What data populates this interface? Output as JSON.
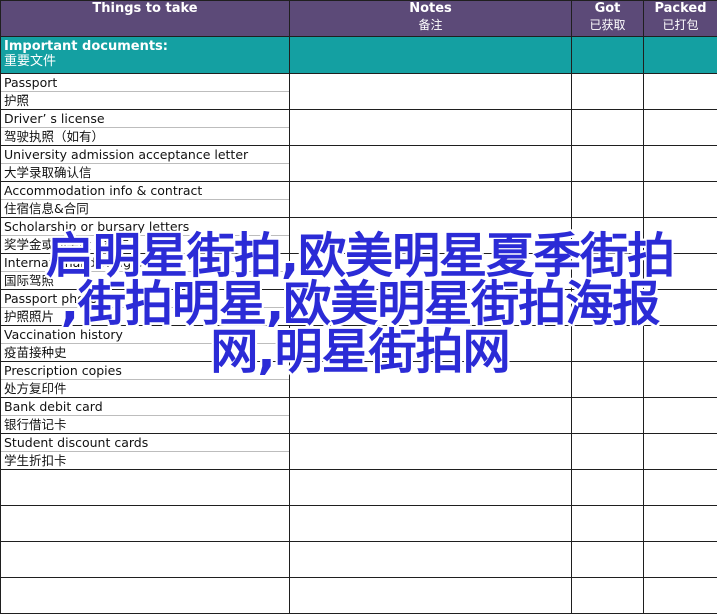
{
  "header": {
    "things": "Things to take",
    "notes_en": "Notes",
    "notes_zh": "备注",
    "got_en": "Got",
    "got_zh": "已获取",
    "packed_en": "Packed",
    "packed_zh": "已打包"
  },
  "section": {
    "title_en": "Important documents:",
    "title_zh": "重要文件"
  },
  "items": [
    {
      "en": "Passport",
      "zh": "护照"
    },
    {
      "en": "Driver’ s license",
      "zh": "驾驶执照（如有）"
    },
    {
      "en": "University admission acceptance letter",
      "zh": "大学录取确认信"
    },
    {
      "en": "Accommodation info & contract",
      "zh": "住宿信息&合同"
    },
    {
      "en": "Scholarship or bursary letters",
      "zh": "奖学金或助学金（如有）"
    },
    {
      "en": "International driving permit",
      "zh": "国际驾照"
    },
    {
      "en": "Passport photos",
      "zh": "护照照片"
    },
    {
      "en": "Vaccination history",
      "zh": "疫苗接种史"
    },
    {
      "en": "Prescription copies",
      "zh": "处方复印件"
    },
    {
      "en": "Bank debit card",
      "zh": "银行借记卡"
    },
    {
      "en": "Student discount cards",
      "zh": "学生折扣卡"
    }
  ],
  "empty_rows": 4,
  "watermark": {
    "line1": "启明星街拍,欧美明星夏季街拍",
    "line2": ",街拍明星,欧美明星街拍海报",
    "line3": "网,明星街拍网"
  }
}
